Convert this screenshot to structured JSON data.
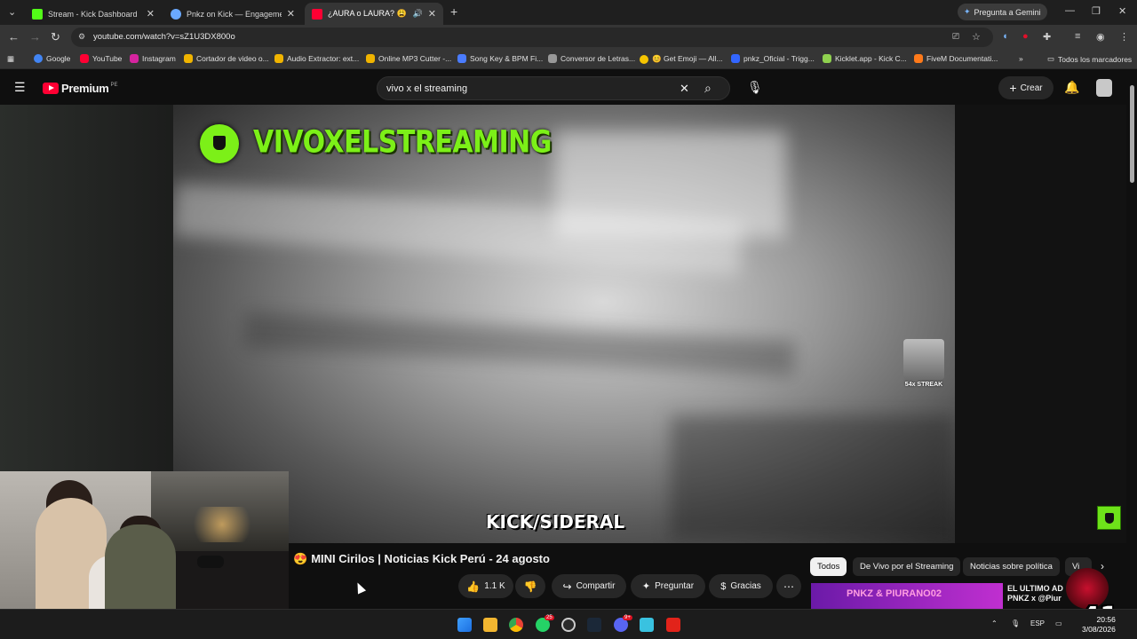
{
  "browser": {
    "tabs": [
      {
        "title": "Stream - Kick Dashboard",
        "color": "#53fc18"
      },
      {
        "title": "Pnkz on Kick — Engagement A",
        "color": "#6aa9ff"
      },
      {
        "title": "¿AURA o LAURA? 😩 Be",
        "color": "#ff0033"
      }
    ],
    "new_tab": "+",
    "gemini": "Pregunta a Gemini",
    "url": "youtube.com/watch?v=sZ1U3DX800o",
    "bookmarks": [
      {
        "label": "Google",
        "color": "#4285f4"
      },
      {
        "label": "YouTube",
        "color": "#ff0033"
      },
      {
        "label": "Instagram",
        "color": "#d6249f"
      },
      {
        "label": "Cortador de video o...",
        "color": "#f0b400"
      },
      {
        "label": "Audio Extractor: ext...",
        "color": "#f0b400"
      },
      {
        "label": "Online MP3 Cutter -...",
        "color": "#f0b400"
      },
      {
        "label": "Song Key & BPM Fi...",
        "color": "#4a7cff"
      },
      {
        "label": "Conversor de Letras...",
        "color": "#999999"
      },
      {
        "label": "😊 Get Emoji — All...",
        "color": "#f5c400"
      },
      {
        "label": "pnkz_Oficial - Trigg...",
        "color": "#3366ff"
      },
      {
        "label": "Kicklet.app - Kick C...",
        "color": "#8fd14f"
      },
      {
        "label": "FiveM Documentati...",
        "color": "#ff7a1a"
      }
    ],
    "all_bookmarks": "Todos los marcadores"
  },
  "youtube": {
    "logo": "Premium",
    "country": "PE",
    "search_value": "vivo x el streaming",
    "create_label": "Crear"
  },
  "video": {
    "channel_overlay": "VIVOXELSTREAMING",
    "streak_label": "54x STREAK",
    "kick_tag": "KICK/SIDERAL"
  },
  "below": {
    "title": "MINI Cirilos | Noticias Kick Perú - 24 agosto",
    "likes": "1.1 K",
    "share": "Compartir",
    "ask": "Preguntar",
    "thanks": "Gracias",
    "chips": [
      "Todos",
      "De Vivo por el Streaming",
      "Noticias sobre política",
      "Vi"
    ],
    "rec_thumb_text": "PNKZ & PIURANO02",
    "rec_title": "EL ULTIMO AD PNKZ x @Piur"
  },
  "overlay": {
    "counter": "x41"
  },
  "taskbar": {
    "whatsapp_badge": "25",
    "discord_badge": "9+",
    "lang": "ESP",
    "time": "20:56",
    "date": "3/08/2026"
  }
}
